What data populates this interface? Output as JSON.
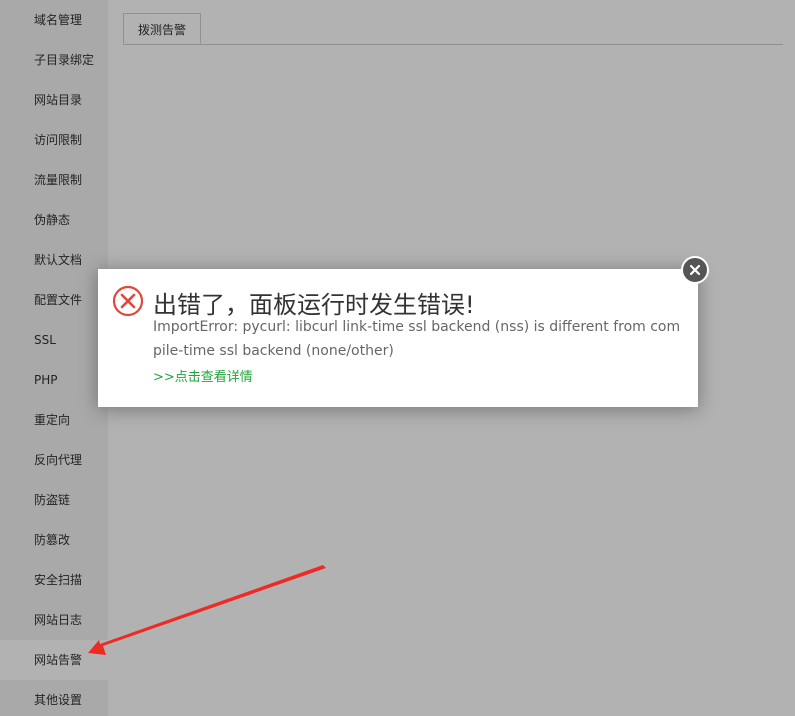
{
  "sidebar": {
    "items": [
      {
        "label": "域名管理"
      },
      {
        "label": "子目录绑定"
      },
      {
        "label": "网站目录"
      },
      {
        "label": "访问限制"
      },
      {
        "label": "流量限制"
      },
      {
        "label": "伪静态"
      },
      {
        "label": "默认文档"
      },
      {
        "label": "配置文件"
      },
      {
        "label": "SSL"
      },
      {
        "label": "PHP"
      },
      {
        "label": "重定向"
      },
      {
        "label": "反向代理"
      },
      {
        "label": "防盗链"
      },
      {
        "label": "防篡改"
      },
      {
        "label": "安全扫描"
      },
      {
        "label": "网站日志"
      },
      {
        "label": "网站告警"
      },
      {
        "label": "其他设置"
      }
    ],
    "active_index": 16
  },
  "main": {
    "tab_label": "拨测告警"
  },
  "dialog": {
    "title": "出错了，面板运行时发生错误!",
    "message": "ImportError: pycurl: libcurl link-time ssl backend (nss) is different from compile-time ssl backend (none/other)",
    "link_label": ">>点击查看详情",
    "error_icon": "error-x-circle-icon",
    "close_icon": "close-icon"
  },
  "colors": {
    "error_red": "#e0483b",
    "link_green": "#20a53a",
    "arrow_red": "#ee2a24"
  }
}
